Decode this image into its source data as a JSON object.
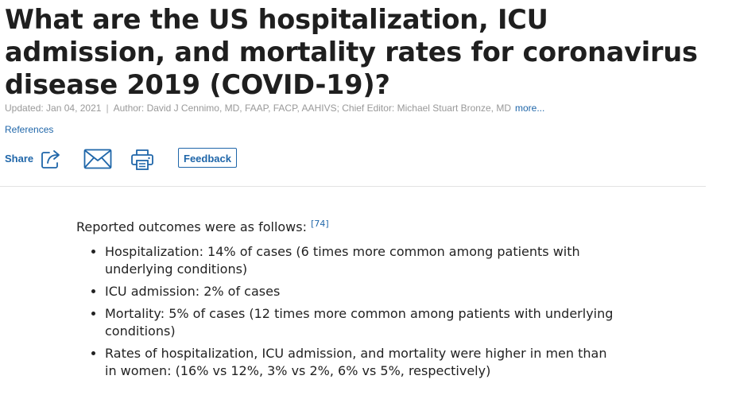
{
  "article": {
    "title": "What are the US hospitalization, ICU admission, and mortality rates for coronavirus disease 2019 (COVID-19)?",
    "updated": "Updated: Jan 04, 2021",
    "separator": "|",
    "authors": "Author: David J Cennimo, MD, FAAP, FACP, AAHIVS; Chief Editor: Michael Stuart Bronze, MD",
    "more_label": "more...",
    "references_label": "References"
  },
  "toolbar": {
    "share_label": "Share",
    "feedback_label": "Feedback",
    "icons": [
      "share-icon",
      "email-icon",
      "print-icon"
    ],
    "accent_color": "#1f66a9"
  },
  "content": {
    "intro": "Reported outcomes were as follows:",
    "citation": "[74]",
    "items": [
      "Hospitalization: 14% of cases (6 times more common among patients with underlying conditions)",
      "ICU admission: 2% of cases",
      "Mortality: 5% of cases (12 times more common among patients with underlying conditions)",
      "Rates of hospitalization, ICU admission, and mortality were higher in men than in women: (16% vs 12%, 3% vs 2%, 6% vs 5%, respectively)"
    ]
  }
}
